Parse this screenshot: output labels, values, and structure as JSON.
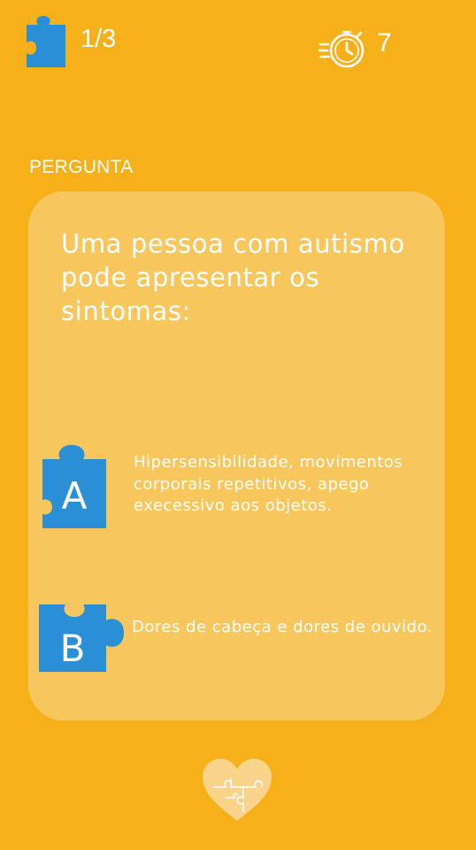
{
  "header": {
    "progress": "1/3",
    "timer_seconds": "7"
  },
  "section_label": "PERGUNTA",
  "question": "Uma pessoa com autismo pode apresentar os sintomas:",
  "answers": [
    {
      "letter": "A",
      "text": "Hipersensibilidade, movimentos corporais repetitivos, apego execessivo aos objetos."
    },
    {
      "letter": "B",
      "text": "Dores de cabeça e dores de ouvido."
    }
  ],
  "colors": {
    "background": "#f5b01a",
    "card": "#f7c65c",
    "puzzle_blue": "#2b8fd6",
    "text": "#ffffff"
  },
  "icons": {
    "progress": "puzzle-piece-icon",
    "timer": "stopwatch-icon",
    "logo": "puzzle-heart-icon"
  }
}
